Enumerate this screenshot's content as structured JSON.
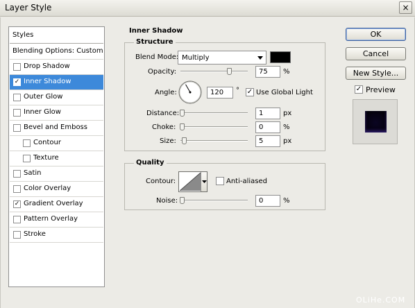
{
  "window": {
    "title": "Layer Style",
    "close_glyph": "×"
  },
  "styles_panel": {
    "header": "Styles",
    "items": [
      {
        "label": "Blending Options: Custom",
        "has_checkbox": false,
        "checked": false,
        "indent": false,
        "selected": false
      },
      {
        "label": "Drop Shadow",
        "has_checkbox": true,
        "checked": false,
        "indent": false,
        "selected": false
      },
      {
        "label": "Inner Shadow",
        "has_checkbox": true,
        "checked": true,
        "indent": false,
        "selected": true
      },
      {
        "label": "Outer Glow",
        "has_checkbox": true,
        "checked": false,
        "indent": false,
        "selected": false
      },
      {
        "label": "Inner Glow",
        "has_checkbox": true,
        "checked": false,
        "indent": false,
        "selected": false
      },
      {
        "label": "Bevel and Emboss",
        "has_checkbox": true,
        "checked": false,
        "indent": false,
        "selected": false
      },
      {
        "label": "Contour",
        "has_checkbox": true,
        "checked": false,
        "indent": true,
        "selected": false
      },
      {
        "label": "Texture",
        "has_checkbox": true,
        "checked": false,
        "indent": true,
        "selected": false
      },
      {
        "label": "Satin",
        "has_checkbox": true,
        "checked": false,
        "indent": false,
        "selected": false
      },
      {
        "label": "Color Overlay",
        "has_checkbox": true,
        "checked": false,
        "indent": false,
        "selected": false
      },
      {
        "label": "Gradient Overlay",
        "has_checkbox": true,
        "checked": true,
        "indent": false,
        "selected": false
      },
      {
        "label": "Pattern Overlay",
        "has_checkbox": true,
        "checked": false,
        "indent": false,
        "selected": false
      },
      {
        "label": "Stroke",
        "has_checkbox": true,
        "checked": false,
        "indent": false,
        "selected": false
      }
    ]
  },
  "inner_shadow": {
    "section_title": "Inner Shadow",
    "structure": {
      "title": "Structure",
      "blend_mode_label": "Blend Mode:",
      "blend_mode_value": "Multiply",
      "shadow_color": "#000000",
      "opacity_label": "Opacity:",
      "opacity_value": "75",
      "opacity_unit": "%",
      "opacity_level": 0.75,
      "angle_label": "Angle:",
      "angle_value": "120",
      "angle_unit": "°",
      "angle_degrees": 120,
      "use_global_light_label": "Use Global Light",
      "use_global_light_checked": true,
      "distance_label": "Distance:",
      "distance_value": "1",
      "distance_unit": "px",
      "distance_level": 0.0,
      "choke_label": "Choke:",
      "choke_value": "0",
      "choke_unit": "%",
      "choke_level": 0.0,
      "size_label": "Size:",
      "size_value": "5",
      "size_unit": "px",
      "size_level": 0.03
    },
    "quality": {
      "title": "Quality",
      "contour_label": "Contour:",
      "anti_aliased_label": "Anti-aliased",
      "anti_aliased_checked": false,
      "noise_label": "Noise:",
      "noise_value": "0",
      "noise_unit": "%",
      "noise_level": 0.0
    }
  },
  "buttons": {
    "ok": "OK",
    "cancel": "Cancel",
    "new_style": "New Style..."
  },
  "preview": {
    "label": "Preview",
    "checked": true
  },
  "watermark": "OLiHe.COM",
  "colors": {
    "selection": "#3d89da",
    "dialog_bg": "#ecebe6"
  }
}
